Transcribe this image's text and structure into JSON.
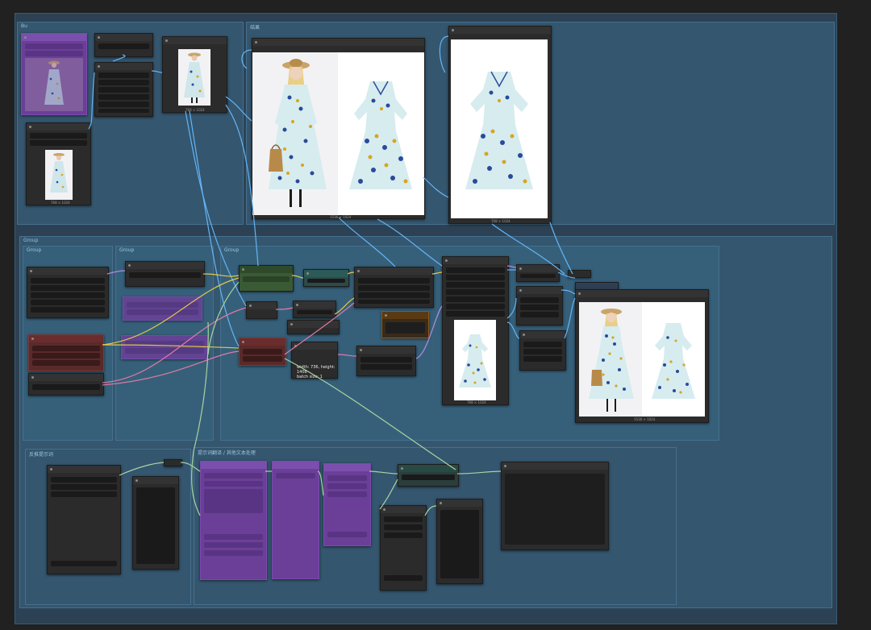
{
  "groups": {
    "top_left": "Bu",
    "top_right": "结果",
    "middle": "Group",
    "middle_sub1": "Group",
    "middle_sub2": "Group",
    "middle_sub3": "Group",
    "bottom_left": "反推提示词",
    "bottom_right": "提示词翻译 / 其他文本处理"
  },
  "captions": {
    "input_preview": "768 × 1024",
    "loader_preview": "768 × 1024",
    "compare_result": "1536 × 1024",
    "garment_result": "768 × 1024",
    "mid_preview": "768 × 1024",
    "final_result": "1536 × 1024"
  },
  "info": {
    "line1": "width: 736, height: 1408",
    "line2": "batch size: 1"
  },
  "colors": {
    "canvas_bg": "#212121",
    "group_bg": "#34566f",
    "wire_blue": "#64b5f6",
    "wire_yellow": "#e5c84a",
    "wire_pink": "#e07aa5",
    "wire_green": "#a9d3a0",
    "wire_purple": "#b48ce0"
  }
}
